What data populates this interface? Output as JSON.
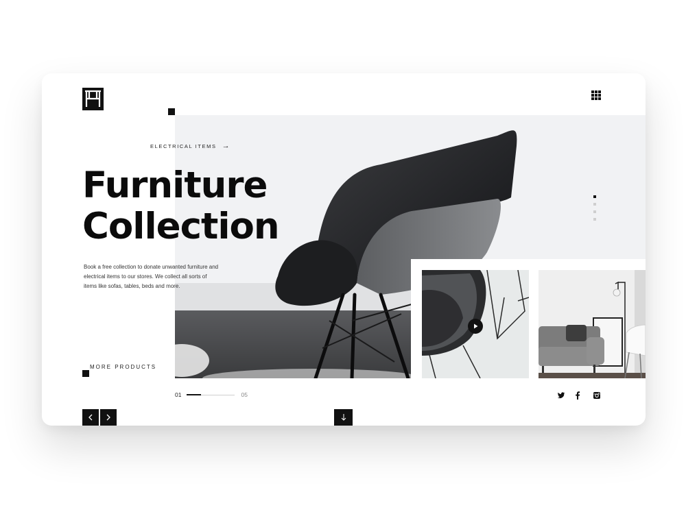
{
  "brand": {
    "logo_name": "chair-logo"
  },
  "header": {
    "menu_icon": "grid-menu-icon"
  },
  "hero": {
    "category_label": "ELECTRICAL ITEMS",
    "category_arrow": "→",
    "title_line1": "Furniture",
    "title_line2": "Collection",
    "description": "Book a free collection to donate unwanted furniture and electrical items to our stores. We collect all sorts of items like sofas, tables, beds and more.",
    "more_label": "MORE PRODUCTS"
  },
  "slider": {
    "current": "01",
    "total": "05",
    "progress": 0.3,
    "dots_total": 4,
    "dots_active": 1
  },
  "thumbnails": [
    {
      "name": "chair-video-thumbnail",
      "has_play": true
    },
    {
      "name": "living-room-thumbnail",
      "has_play": false
    }
  ],
  "social": [
    "twitter-icon",
    "facebook-icon",
    "instagram-icon"
  ],
  "colors": {
    "accent": "#111111",
    "background": "#ffffff"
  }
}
